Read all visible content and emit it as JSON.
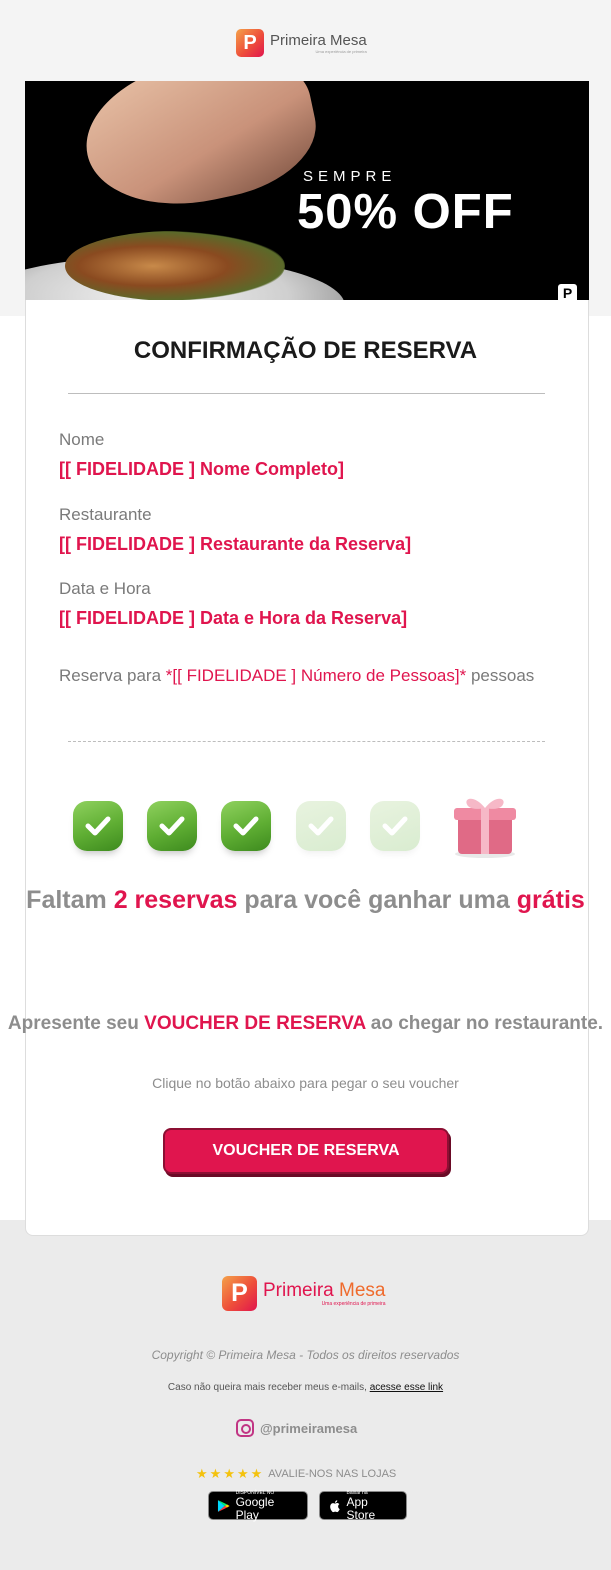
{
  "header": {
    "logo_letter": "P",
    "logo_name": "Primeira Mesa",
    "logo_tagline": "Uma experiência de primeira"
  },
  "banner": {
    "line1": "SEMPRE",
    "line2": "50% OFF",
    "badge": "P"
  },
  "card": {
    "title": "CONFIRMAÇÃO DE RESERVA",
    "fields": [
      {
        "label": "Nome",
        "value": "[[ FIDELIDADE ] Nome Completo]"
      },
      {
        "label": "Restaurante",
        "value": "[[ FIDELIDADE ] Restaurante da Reserva]"
      },
      {
        "label": "Data e Hora",
        "value": "[[ FIDELIDADE ] Data e Hora da Reserva]"
      }
    ],
    "reserva_prefix": "Reserva para ",
    "reserva_value": "*[[ FIDELIDADE ] Número de Pessoas]*",
    "reserva_suffix": " pessoas",
    "progress": {
      "completed": 3,
      "total": 5
    },
    "faltam_pre": "Faltam ",
    "faltam_count": "2 reservas",
    "faltam_mid": " para você ganhar uma ",
    "faltam_end": "grátis",
    "apresente_pre": "Apresente seu ",
    "apresente_hl": "VOUCHER DE RESERVA",
    "apresente_post": " ao chegar no restaurante.",
    "clique": "Clique no botão abaixo para pegar o seu voucher",
    "voucher_button": "VOUCHER DE RESERVA"
  },
  "footer": {
    "logo_letter": "P",
    "logo_name_1": "Primeira",
    "logo_name_2": " Mesa",
    "logo_tagline": "Uma experiência de primeira",
    "copyright": "Copyright © Primeira Mesa - Todos os direitos reservados",
    "unsub_text": "Caso não queira mais receber meus e-mails, ",
    "unsub_link": "acesse esse link",
    "instagram": "@primeiramesa",
    "rating_stars": 5,
    "rate_text": "AVALIE-NOS NAS LOJAS",
    "google_small": "DISPONÍVEL NO",
    "google_big": "Google Play",
    "apple_small": "Baixar na",
    "apple_big": "App Store"
  },
  "colors": {
    "accent": "#e0154e",
    "grey_text": "#8d8d8d",
    "check_green": "#5fae33"
  }
}
